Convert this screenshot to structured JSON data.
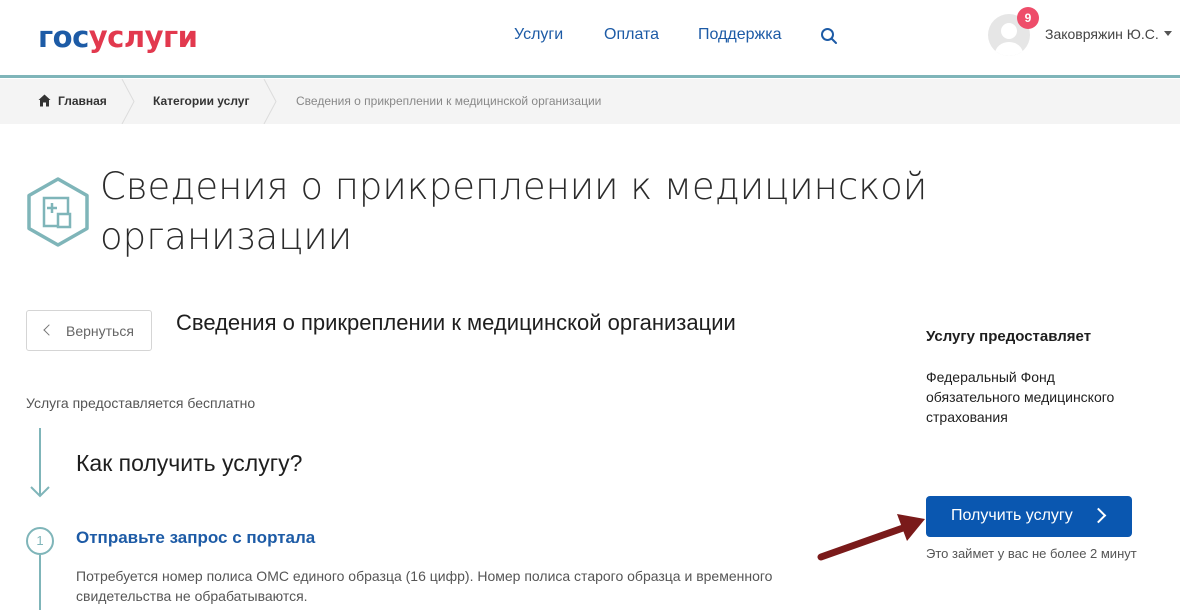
{
  "header": {
    "logo_part1": "гос",
    "logo_part2": "услуги",
    "nav": [
      "Услуги",
      "Оплата",
      "Поддержка"
    ],
    "search_icon": "search-icon",
    "notifications_count": "9",
    "user_name": "Заковряжин Ю.С."
  },
  "breadcrumbs": [
    "Главная",
    "Категории услуг",
    "Сведения о прикреплении к медицинской организации"
  ],
  "page": {
    "title": "Сведения о прикреплении к медицинской организации",
    "icon": "medical-building-icon",
    "back_label": "Вернуться",
    "service_title": "Сведения о прикреплении к медицинской организации",
    "free_text": "Услуга предоставляется бесплатно",
    "how_title": "Как получить услугу?",
    "steps": [
      {
        "number": "1",
        "title": "Отправьте запрос с портала",
        "description": "Потребуется номер полиса ОМС единого образца (16 цифр). Номер полиса старого образца и временного свидетельства не обрабатываются."
      }
    ]
  },
  "sidebar": {
    "provider_label": "Услугу предоставляет",
    "provider_name": "Федеральный Фонд обязательного медицинского страхования",
    "get_button": "Получить услугу",
    "time_note": "Это займет у вас не более 2 минут"
  },
  "colors": {
    "brand_blue": "#1d5ba6",
    "brand_red": "#e2394e",
    "teal": "#7fb5b9",
    "button_blue": "#0a57b0",
    "badge_pink": "#ee4d6a",
    "annotation_arrow": "#7a1a1a"
  }
}
